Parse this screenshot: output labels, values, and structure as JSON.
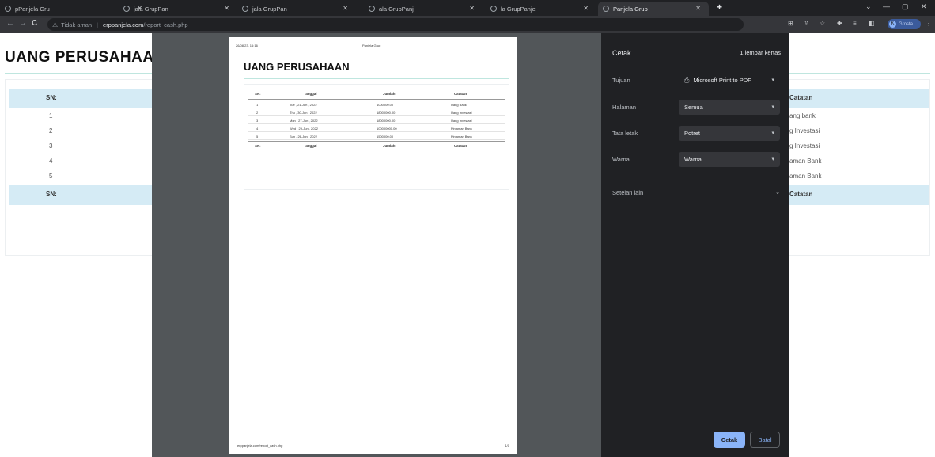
{
  "browser": {
    "tabs": [
      {
        "title": "pPanjela Gru",
        "active": false
      },
      {
        "title": "jala GrupPan",
        "active": false
      },
      {
        "title": "jala GrupPan",
        "active": false
      },
      {
        "title": "ala GrupPanj",
        "active": false
      },
      {
        "title": "la GrupPanje",
        "active": false
      },
      {
        "title": "Panjela Grup",
        "active": true
      }
    ],
    "new_tab": "+",
    "window_controls": {
      "minimize": "—",
      "maximize": "▢",
      "close": "✕",
      "tab_search": "⌄"
    },
    "nav": {
      "back": "←",
      "forward": "→",
      "reload": "C"
    },
    "address": {
      "security": "Tidak aman",
      "host": "erppanjela.com",
      "path": "/report_cash.php"
    },
    "profile": {
      "initial": "K",
      "label": "Grosta"
    }
  },
  "page": {
    "title": "UANG PERUSAHAAN",
    "table": {
      "header_sn": "SN:",
      "header_catatan": "Catatan",
      "rows": [
        {
          "sn": "1",
          "catatan_partial": "ang bank"
        },
        {
          "sn": "2",
          "catatan_partial": "g Investasi"
        },
        {
          "sn": "3",
          "catatan_partial": "g Investasi"
        },
        {
          "sn": "4",
          "catatan_partial": "aman Bank"
        },
        {
          "sn": "5",
          "catatan_partial": "aman Bank"
        }
      ],
      "footer_sn": "SN:",
      "footer_catatan": "Catatan"
    }
  },
  "preview": {
    "header_left": "26/08/23, 16:16",
    "header_center": "Panjela Grup",
    "title": "UANG PERUSAHAAN",
    "columns": [
      "SN:",
      "Tanggal",
      "Jumlah",
      "Catatan"
    ],
    "rows": [
      [
        "1",
        "Tue , 21-Jun , 2022",
        "1000000.00",
        "Uang Bank"
      ],
      [
        "2",
        "Thu , 30-Jun , 2022",
        "18000000.00",
        "Uang Investasi"
      ],
      [
        "3",
        "Mon , 27-Jun , 2022",
        "18000000.00",
        "Uang Investasi"
      ],
      [
        "4",
        "Wed , 29-Jun , 2022",
        "100000000.00",
        "Pinjaman Bank"
      ],
      [
        "5",
        "Sun , 26-Jun , 2022",
        "1500000.00",
        "Pinjaman Bank"
      ]
    ],
    "footer_row": [
      "SN:",
      "Tanggal",
      "Jumlah",
      "Catatan"
    ],
    "footer_left": "erppanjela.com/report_cash.php",
    "footer_right": "1/1"
  },
  "print_panel": {
    "title": "Cetak",
    "pages_count": "1 lembar kertas",
    "destination_label": "Tujuan",
    "destination_value": "Microsoft Print to PDF",
    "pages_label": "Halaman",
    "pages_value": "Semua",
    "layout_label": "Tata letak",
    "layout_value": "Potret",
    "color_label": "Warna",
    "color_value": "Warna",
    "more_settings": "Setelan lain",
    "print_button": "Cetak",
    "cancel_button": "Batal"
  }
}
